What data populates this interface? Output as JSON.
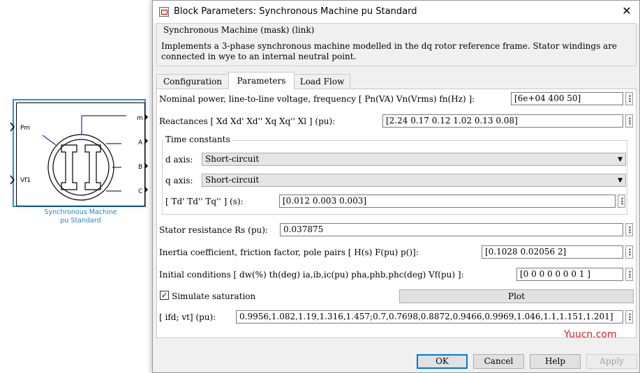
{
  "block": {
    "caption_line1": "Synchronous Machine",
    "caption_line2": "pu Standard",
    "ports_in": [
      "Pm",
      "Vf1"
    ],
    "ports_out": [
      "m",
      "A",
      "B",
      "C"
    ]
  },
  "dialog": {
    "title": "Block Parameters: Synchronous Machine pu Standard",
    "close": "✕",
    "mask_title": "Synchronous Machine (mask) (link)",
    "mask_description": "Implements a 3-phase synchronous machine modelled in the dq rotor reference frame. Stator windings are connected in wye to an internal neutral point.",
    "tabs": [
      "Configuration",
      "Parameters",
      "Load Flow"
    ],
    "active_tab": "Parameters",
    "params": {
      "nominal_label": "Nominal power, line-to-line voltage, frequency [ Pn(VA)  Vn(Vrms)  fn(Hz) ]:",
      "nominal_value": "[6e+04 400 50]",
      "reactances_label": "Reactances [ Xd  Xd'  Xd''  Xq  Xq''  Xl ] (pu):",
      "reactances_value": "[2.24 0.17 0.12 1.02 0.13 0.08]",
      "time_constants_title": "Time constants",
      "d_axis_label": "d axis:",
      "d_axis_value": "Short-circuit",
      "q_axis_label": "q axis:",
      "q_axis_value": "Short-circuit",
      "tc_label": "[ Td'  Td''  Tq'' ] (s):",
      "tc_value": "[0.012 0.003 0.003]",
      "stator_label": "Stator resistance Rs (pu):",
      "stator_value": "0.037875",
      "inertia_label": "Inertia coefficient, friction factor, pole pairs [ H(s)  F(pu)  p()]:",
      "inertia_value": "[0.1028 0.02056 2]",
      "initial_label": "Initial conditions [ dw(%)  th(deg)  ia,ib,ic(pu)  pha,phb,phc(deg)  Vf(pu) ]:",
      "initial_value": "[0  0  0  0  0  0  0  1 ]",
      "saturation_label": "Simulate saturation",
      "saturation_checked": "✓",
      "plot_label": "Plot",
      "ifd_label": "[ ifd; vt] (pu):",
      "ifd_value": "0.9956,1.082,1.19,1.316,1.457;0.7,0.7698,0.8872,0.9466,0.9969,1.046,1.1,1.151,1.201]",
      "more": "⋮"
    },
    "buttons": {
      "ok": "OK",
      "cancel": "Cancel",
      "help": "Help",
      "apply": "Apply"
    }
  },
  "watermark": "Yuucn.com",
  "colors": {
    "block_border": "#1e90ff",
    "caption": "#1e7fd2",
    "ok_border": "#0078d7",
    "watermark": "#d0202a"
  }
}
